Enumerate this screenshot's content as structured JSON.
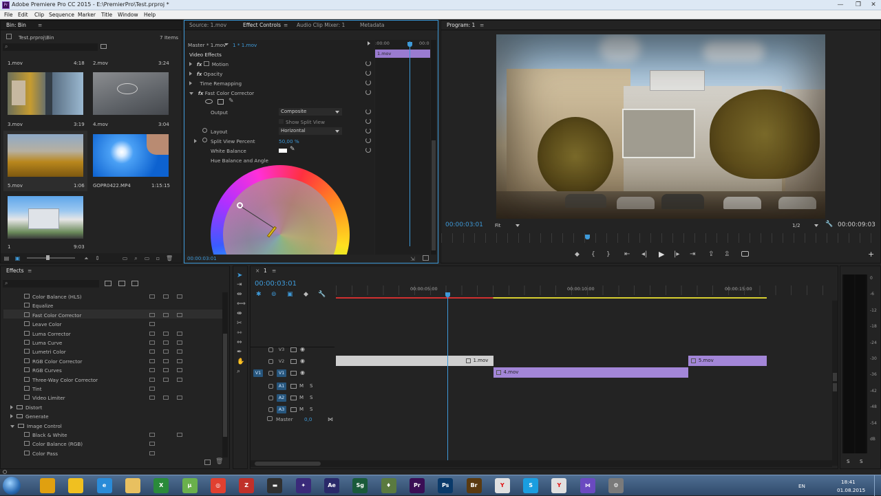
{
  "window": {
    "title": "Adobe Premiere Pro CC 2015 - E:\\PremierPro\\Test.prproj *"
  },
  "menu": [
    "File",
    "Edit",
    "Clip",
    "Sequence",
    "Marker",
    "Title",
    "Window",
    "Help"
  ],
  "bin": {
    "tab": "Bin: Bin",
    "path": "Test.prproj\\Bin",
    "count": "7 Items",
    "items": [
      {
        "name": "1.mov",
        "dur": "4:18"
      },
      {
        "name": "2.mov",
        "dur": "3:24"
      },
      {
        "name": "3.mov",
        "dur": "3:19"
      },
      {
        "name": "4.mov",
        "dur": "3:04"
      },
      {
        "name": "5.mov",
        "dur": "1:06"
      },
      {
        "name": "GOPR0422.MP4",
        "dur": "1:15:15"
      },
      {
        "name": "1",
        "dur": "9:03"
      }
    ]
  },
  "effect_controls": {
    "tabs": [
      "Source: 1.mov",
      "Effect Controls",
      "Audio Clip Mixer: 1",
      "Metadata"
    ],
    "master": "Master * 1.mov",
    "clip": "1 * 1.mov",
    "section": "Video Effects",
    "effects": [
      "Motion",
      "Opacity",
      "Time Remapping",
      "Fast Color Corrector"
    ],
    "output_label": "Output",
    "output_value": "Composite",
    "show_split": "Show Split View",
    "layout_label": "Layout",
    "layout_value": "Horizontal",
    "split_label": "Split View Percent",
    "split_value": "50,00 %",
    "white_balance": "White Balance",
    "hue_label": "Hue Balance and Angle",
    "mini_time1": ":00:00",
    "mini_time2": "00:0",
    "mini_clip": "1.mov",
    "timecode": "00:00:03:01"
  },
  "program": {
    "tab": "Program: 1",
    "timecode": "00:00:03:01",
    "fit": "Fit",
    "res": "1/2",
    "duration": "00:00:09:03"
  },
  "effects_panel": {
    "tab": "Effects",
    "items": [
      {
        "name": "Color Balance (HLS)",
        "kind": "fx"
      },
      {
        "name": "Equalize",
        "kind": "fx"
      },
      {
        "name": "Fast Color Corrector",
        "kind": "fx"
      },
      {
        "name": "Leave Color",
        "kind": "fx"
      },
      {
        "name": "Luma Corrector",
        "kind": "fx"
      },
      {
        "name": "Luma Curve",
        "kind": "fx"
      },
      {
        "name": "Lumetri Color",
        "kind": "fx"
      },
      {
        "name": "RGB Color Corrector",
        "kind": "fx"
      },
      {
        "name": "RGB Curves",
        "kind": "fx"
      },
      {
        "name": "Three-Way Color Corrector",
        "kind": "fx"
      },
      {
        "name": "Tint",
        "kind": "fx"
      },
      {
        "name": "Video Limiter",
        "kind": "fx"
      },
      {
        "name": "Distort",
        "kind": "folder"
      },
      {
        "name": "Generate",
        "kind": "folder"
      },
      {
        "name": "Image Control",
        "kind": "folder-open"
      },
      {
        "name": "Black & White",
        "kind": "fx"
      },
      {
        "name": "Color Balance (RGB)",
        "kind": "fx"
      },
      {
        "name": "Color Pass",
        "kind": "fx"
      }
    ]
  },
  "timeline": {
    "tab": "1",
    "timecode": "00:00:03:01",
    "ruler": [
      "00:00:05:00",
      "00:00:10:00",
      "00:00:15:00"
    ],
    "video_tracks": [
      "V3",
      "V2",
      "V1"
    ],
    "audio_tracks": [
      "A1",
      "A2",
      "A3"
    ],
    "source_patch": "V1",
    "master": "Master",
    "master_val": "0,0",
    "clips": [
      {
        "name": "1.mov",
        "track": "V2",
        "start_s": 0,
        "end_s": 5.0,
        "color": "#cfcfcf"
      },
      {
        "name": "5.mov",
        "track": "V2",
        "start_s": 11.2,
        "end_s": 13.7,
        "color": "#a386d8"
      },
      {
        "name": "4.mov",
        "track": "V1",
        "start_s": 5.0,
        "end_s": 11.2,
        "color": "#a386d8"
      }
    ],
    "playhead_s": 3.0,
    "work_end_s": 13.7,
    "rendered_end_s": 5.0
  },
  "meter": {
    "scale": [
      "0",
      "-6",
      "-12",
      "-18",
      "-24",
      "-30",
      "-36",
      "-42",
      "-48",
      "-54",
      "dB"
    ],
    "bottom": [
      "S",
      "S"
    ]
  },
  "taskbar": {
    "apps": [
      "Explorer",
      "Nod",
      "IE",
      "Folder",
      "Excel",
      "Torrent",
      "Chrome",
      "FileZilla",
      "Monitor",
      "Pr",
      "Ae",
      "Sg",
      "Spot",
      "Pr",
      "Ps",
      "Br",
      "Y",
      "Skype",
      "Y",
      "VS",
      "Tools"
    ],
    "lang": "EN",
    "time": "18:41",
    "date": "01.08.2015"
  }
}
